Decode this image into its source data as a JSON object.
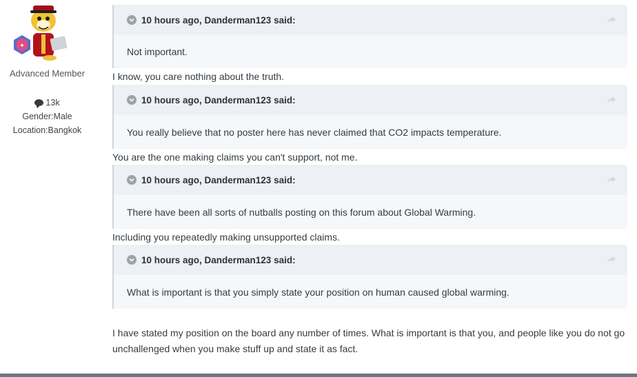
{
  "author": {
    "title": "Advanced Member",
    "post_count": "13k",
    "gender": "Gender:Male",
    "location": "Location:Bangkok",
    "avatar_icon": "cartoon-tiger-avatar",
    "badge_icon": "rank-badge-icon"
  },
  "post": {
    "quotes": [
      {
        "citation": "10 hours ago, Danderman123 said:",
        "body": "Not important.",
        "reply": "I know, you care nothing about the truth."
      },
      {
        "citation": "10 hours ago, Danderman123 said:",
        "body": "You really believe that no poster here has never claimed that CO2 impacts temperature.",
        "reply": "You are the one making claims you can't support, not me."
      },
      {
        "citation": "10 hours ago, Danderman123 said:",
        "body": "There have been all sorts of nutballs posting on this forum about Global Warming.",
        "reply": "Including you repeatedly making unsupported claims."
      },
      {
        "citation": "10 hours ago, Danderman123 said:",
        "body": "What is important is that you simply state your position on human caused global warming.",
        "reply": ""
      }
    ],
    "closing": "I have stated my position on the board any number of times. What is important is that you, and people like you do not go unchallenged when you make stuff up and state it as fact."
  },
  "colors": {
    "quote_bg": "#f6f7f9",
    "quote_header_bg": "#edf0f4",
    "quote_border": "#ced5de",
    "text": "#353c41"
  }
}
